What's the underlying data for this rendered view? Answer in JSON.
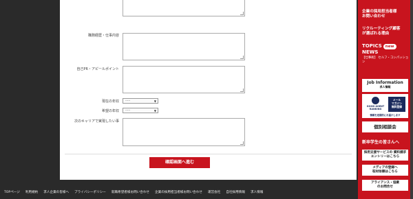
{
  "form": {
    "career_label": "職務経歴・仕事内容",
    "pr_label": "自己PR・アピールポイント",
    "current_salary_label": "現在の年収",
    "desired_salary_label": "希望の年収",
    "future_career_label": "次のキャリアで実現したい事",
    "select_placeholder": "-----",
    "confirm_button": "確認画面へ進む"
  },
  "footer": {
    "links": [
      "TOPページ",
      "利用規約",
      "求人企業の皆様へ",
      "プライバシーポリシー",
      "就職希望者様お問い合わせ",
      "企業の採用担当者様お問い合わせ",
      "運営会社",
      "自社採用情報",
      "求人情報"
    ]
  },
  "sidebar": {
    "contact_heading": "企業の採用担当者様\nお問い合わせ",
    "recruiting_heading": "リクルーティング顧客\nが選ばれる理由",
    "topics_title": "TOPICS",
    "new_badge": "new",
    "news_title": "NEWS",
    "topics_sub": "【仕事術】 セルフ・コンパッション",
    "job_info_title": "Job Information",
    "job_info_sub": "求人情報",
    "good_agent_title": "GOOD AGENT RANKING",
    "mail_magazine": "メール\nマガジン\n無料登録",
    "good_agent_note": "情報を定期的にお届けします",
    "consultation": "個別相談会",
    "new_grad_heading": "新卒学生の皆さんへ",
    "support_service": "採用支援サービスの 資料請求\nエントリーはこちら",
    "media": "メディアの登録へ\n取材依頼はこちら",
    "alliance": "アライアンス・協業\nのお問合せ"
  }
}
